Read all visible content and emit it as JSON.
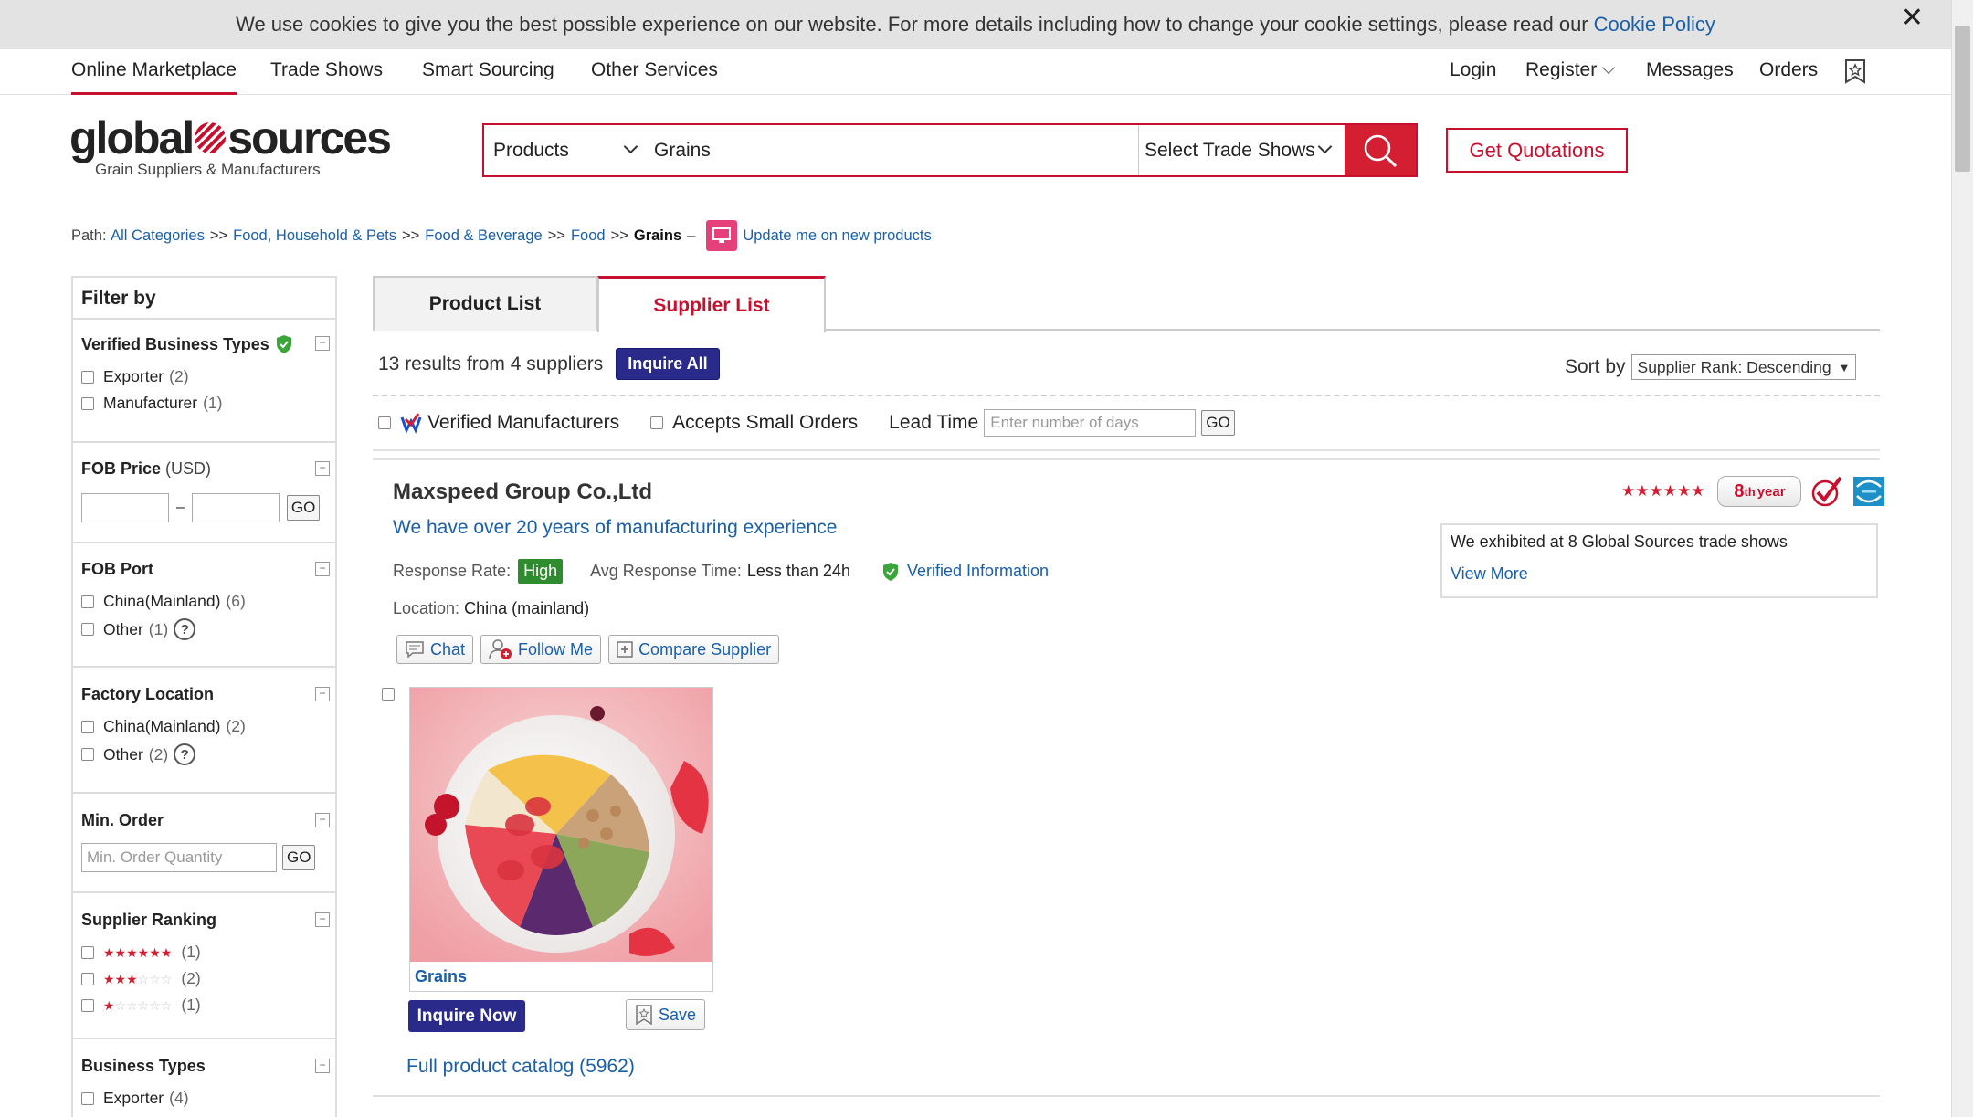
{
  "cookie": {
    "text": "We use cookies to give you the best possible experience on our website. For more details including how to change your cookie settings, please read our",
    "link": "Cookie Policy",
    "close": "✕"
  },
  "topnav": {
    "left": [
      "Online Marketplace",
      "Trade Shows",
      "Smart Sourcing",
      "Other Services"
    ],
    "right": [
      "Login",
      "Register",
      "Messages",
      "Orders"
    ]
  },
  "logo": {
    "brand_a": "global",
    "brand_b": "sources",
    "tagline": "Grain Suppliers & Manufacturers"
  },
  "search": {
    "category": "Products",
    "query": "Grains",
    "trade_shows": "Select Trade Shows"
  },
  "get_quotations": "Get Quotations",
  "breadcrumb": {
    "path_label": "Path:",
    "items": [
      "All Categories",
      "Food, Household & Pets",
      "Food & Beverage",
      "Food"
    ],
    "sep": ">>",
    "current": "Grains",
    "dash": "–",
    "update": "Update me on new products"
  },
  "filter": {
    "title": "Filter by",
    "verified_types": {
      "title": "Verified Business Types",
      "options": [
        {
          "label": "Exporter",
          "count": "(2)"
        },
        {
          "label": "Manufacturer",
          "count": "(1)"
        }
      ]
    },
    "fob_price": {
      "title": "FOB Price",
      "unit": "(USD)",
      "dash": "–",
      "go": "GO"
    },
    "fob_port": {
      "title": "FOB Port",
      "options": [
        {
          "label": "China(Mainland)",
          "count": "(6)"
        },
        {
          "label": "Other",
          "count": "(1)"
        }
      ]
    },
    "factory_location": {
      "title": "Factory Location",
      "options": [
        {
          "label": "China(Mainland)",
          "count": "(2)"
        },
        {
          "label": "Other",
          "count": "(2)"
        }
      ]
    },
    "min_order": {
      "title": "Min. Order",
      "placeholder": "Min. Order Quantity",
      "go": "GO"
    },
    "supplier_ranking": {
      "title": "Supplier Ranking",
      "options": [
        {
          "stars": 6,
          "count": "(1)"
        },
        {
          "stars": 3,
          "count": "(2)"
        },
        {
          "stars": 1,
          "count": "(1)"
        }
      ]
    },
    "business_types": {
      "title": "Business Types",
      "options": [
        {
          "label": "Exporter",
          "count": "(4)"
        }
      ]
    },
    "collapse": "−",
    "help": "?"
  },
  "tabs": {
    "product_list": "Product List",
    "supplier_list": "Supplier List"
  },
  "results": {
    "summary": "13 results from 4 suppliers",
    "inquire_all": "Inquire All"
  },
  "sort": {
    "label": "Sort by",
    "value": "Supplier Rank: Descending",
    "arrow": "▼"
  },
  "filters_row": {
    "verified_manufacturers": "Verified Manufacturers",
    "small_orders": "Accepts Small Orders",
    "lead_time": "Lead Time",
    "lead_placeholder": "Enter number of days",
    "go": "GO"
  },
  "supplier": {
    "name": "Maxspeed Group Co.,Ltd",
    "slogan": "We have over 20 years of manufacturing experience",
    "response_rate_label": "Response Rate:",
    "response_rate": "High",
    "avg_response_label": "Avg Response Time:",
    "avg_response": "Less than 24h",
    "verified_info": "Verified Information",
    "location_label": "Location:",
    "location": "China (mainland)",
    "chat": "Chat",
    "follow": "Follow Me",
    "compare": "Compare Supplier",
    "year_num": "8",
    "year_sup": "th",
    "year_word": "year",
    "exhibited": "We exhibited at 8 Global Sources trade shows",
    "view_more": "View More",
    "star_rating": 6
  },
  "product": {
    "name": "Grains",
    "inquire_now": "Inquire Now",
    "save": "Save",
    "catalog": "Full product catalog (5962)"
  },
  "colors": {
    "brand_red": "#c8102e",
    "button_navy": "#2a2a8a",
    "link_blue": "#1a5fa8",
    "high_green": "#2e8b2e"
  }
}
